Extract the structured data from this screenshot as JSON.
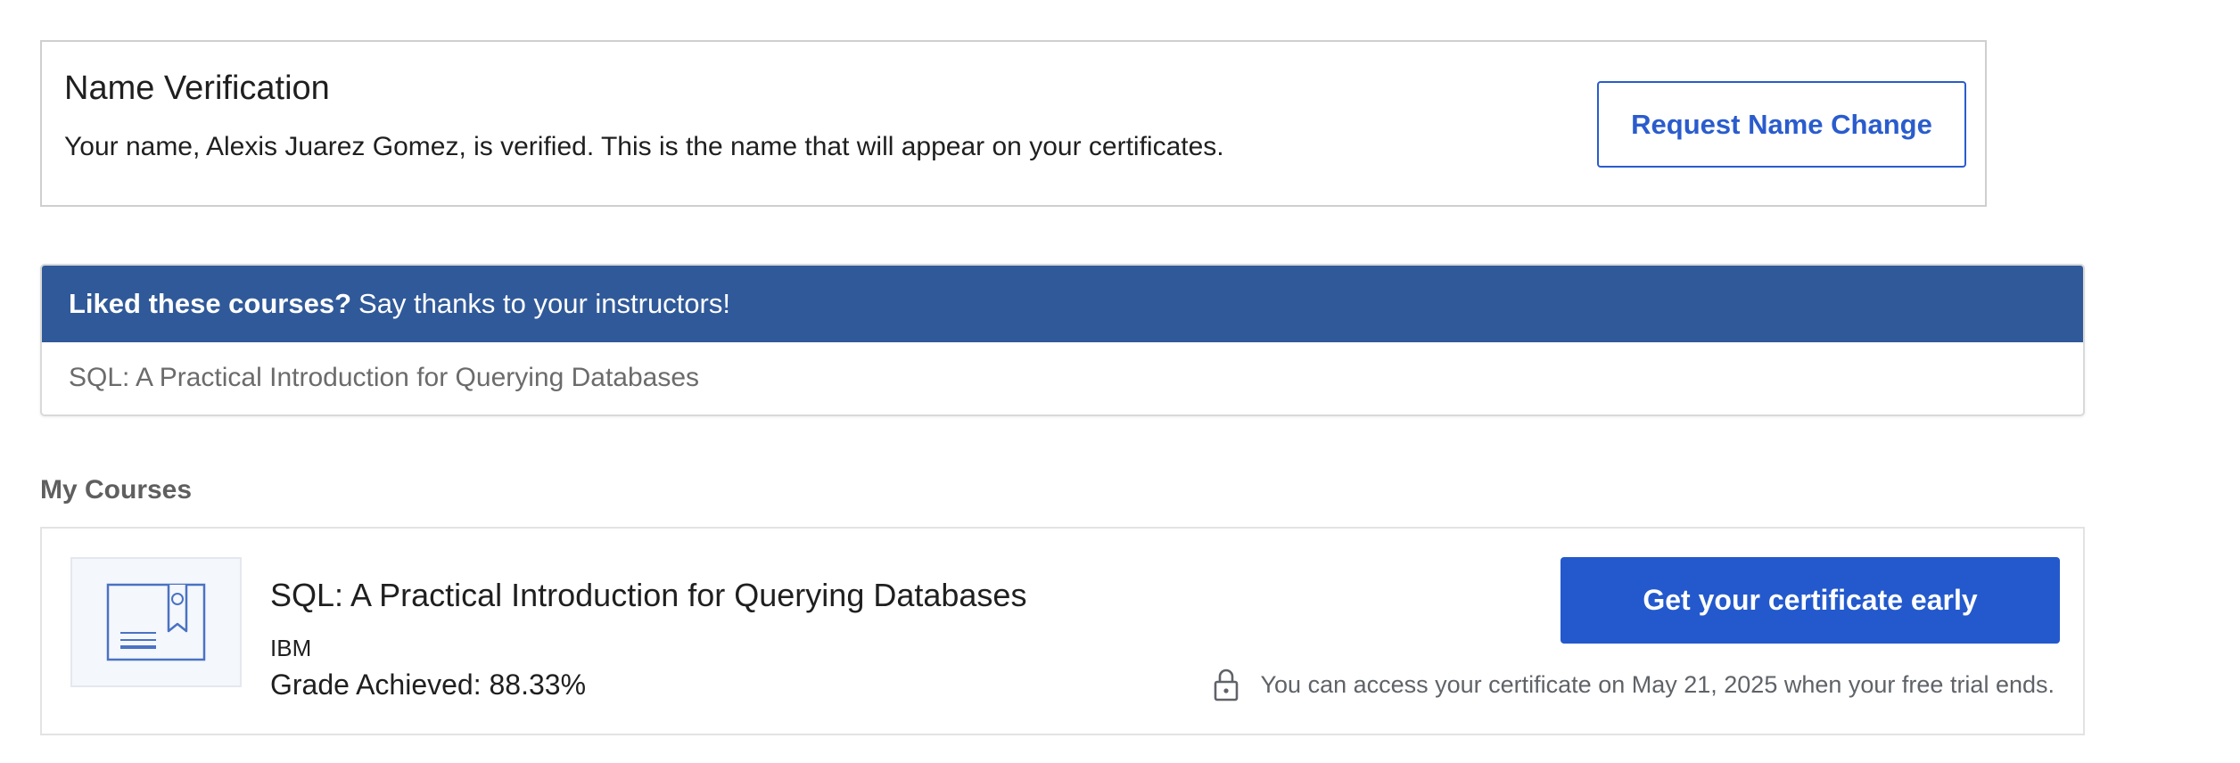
{
  "name_verification": {
    "title": "Name Verification",
    "message": "Your name, Alexis Juarez Gomez, is verified. This is the name that will appear on your certificates.",
    "request_button_label": "Request Name Change"
  },
  "thanks_banner": {
    "bold_text": "Liked these courses?",
    "text": "Say thanks to your instructors!",
    "courses": [
      "SQL: A Practical Introduction for Querying Databases"
    ]
  },
  "my_courses": {
    "heading": "My Courses",
    "items": [
      {
        "thumbnail_icon": "certificate-icon",
        "title": "SQL: A Practical Introduction for Querying Databases",
        "partner": "IBM",
        "grade": "Grade Achieved: 88.33%",
        "cert_button_label": "Get your certificate early",
        "lock_icon": "lock-icon",
        "cert_note": "You can access your certificate on May 21, 2025 when your free trial ends."
      }
    ]
  },
  "colors": {
    "primary_blue": "#2359cc",
    "banner_blue": "#305999",
    "muted_text": "#6b6b6b"
  }
}
